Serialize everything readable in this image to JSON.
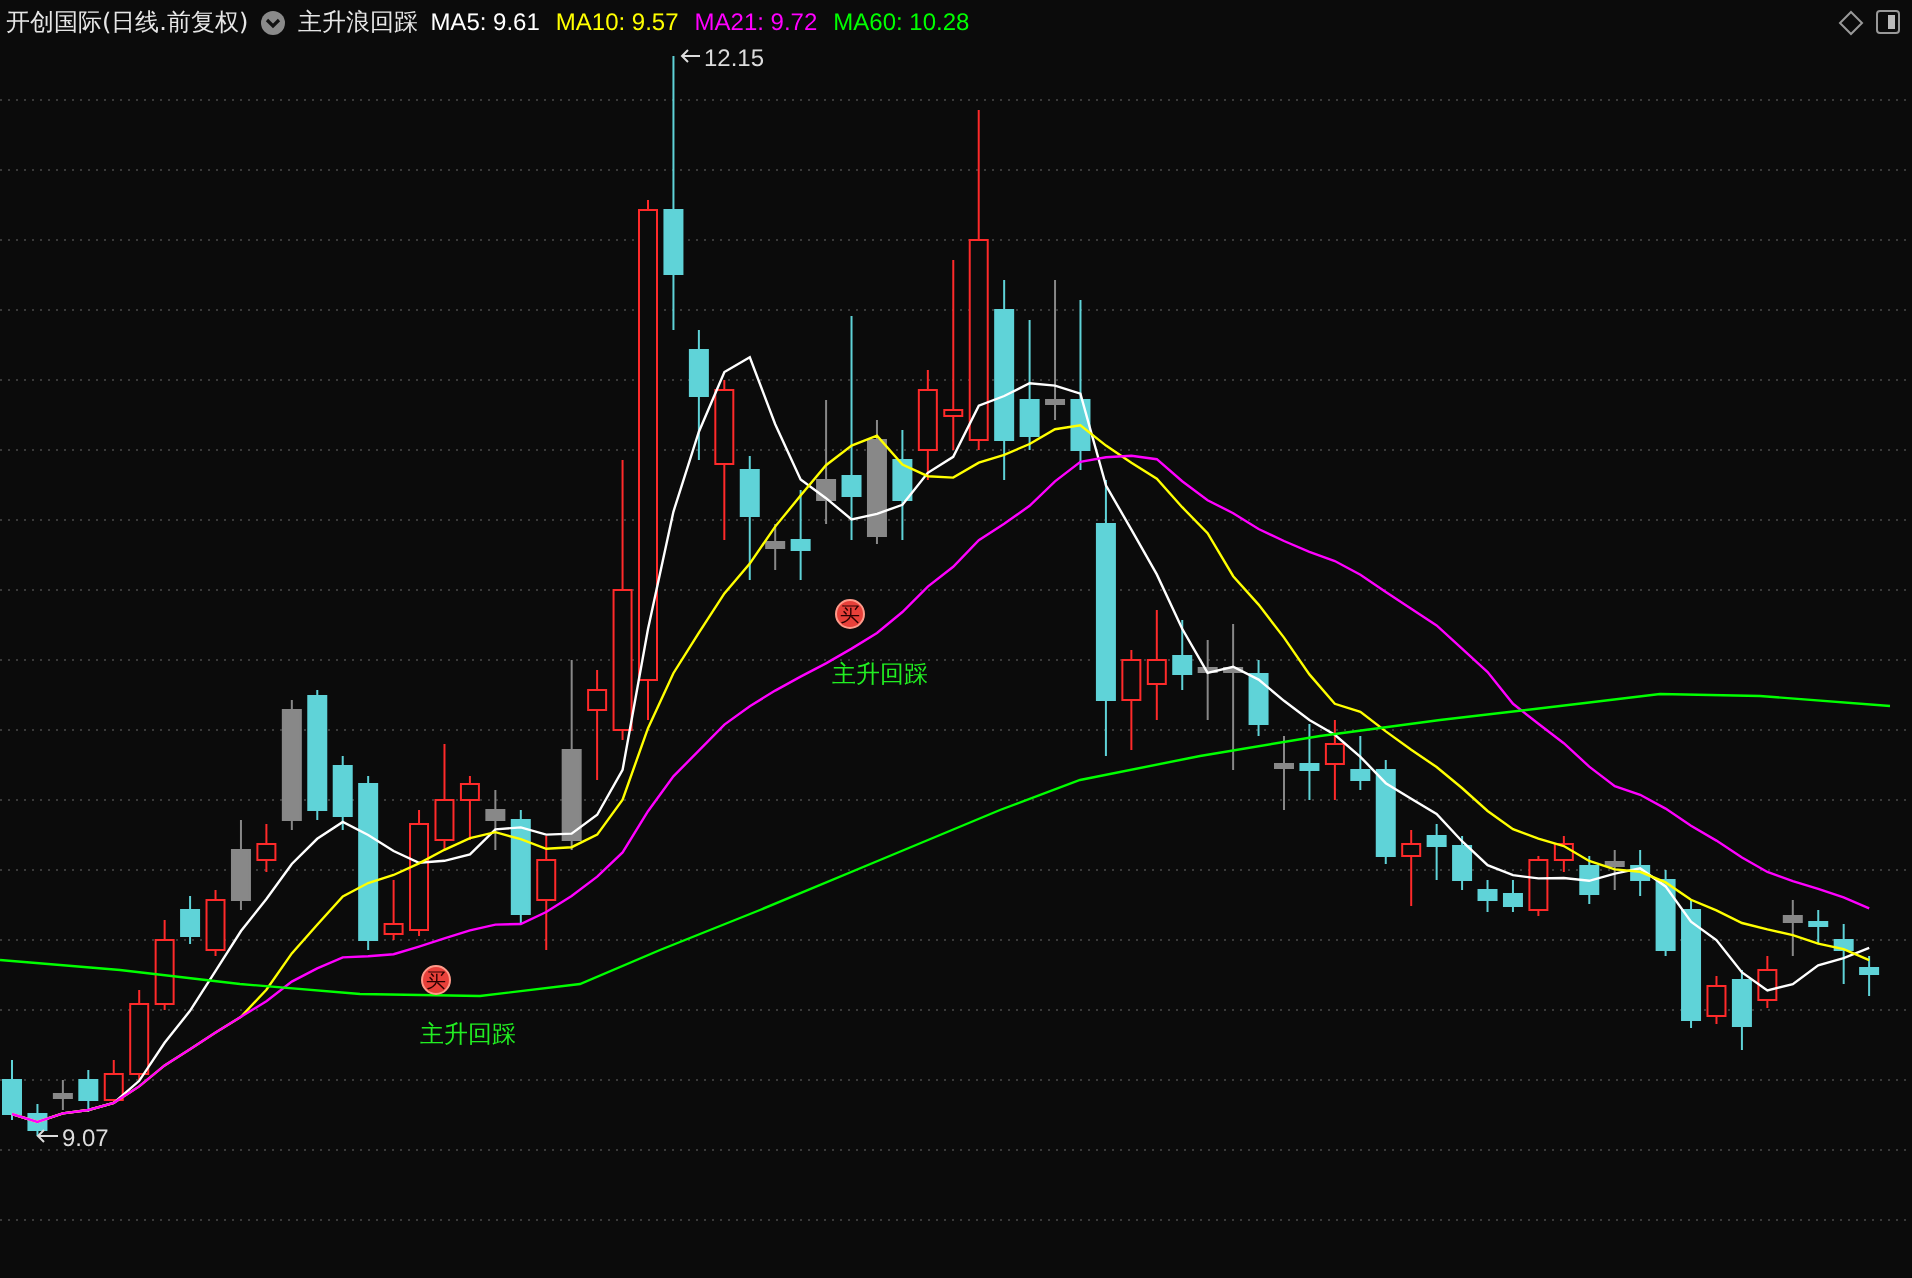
{
  "title": {
    "stock": "开创国际(日线.前复权)",
    "indicator": "主升浪回踩"
  },
  "ma_legend": [
    {
      "label": "MA5: 9.61",
      "color": "#ffffff"
    },
    {
      "label": "MA10: 9.57",
      "color": "#ffff00"
    },
    {
      "label": "MA21: 9.72",
      "color": "#ff00ff"
    },
    {
      "label": "MA60: 10.28",
      "color": "#00ff00"
    }
  ],
  "price_marks": [
    {
      "kind": "high",
      "text": "12.15"
    },
    {
      "kind": "low",
      "text": "9.07"
    }
  ],
  "signals": [
    {
      "badge": "买",
      "label": "主升回踩"
    },
    {
      "badge": "买",
      "label": "主升回踩"
    }
  ]
}
